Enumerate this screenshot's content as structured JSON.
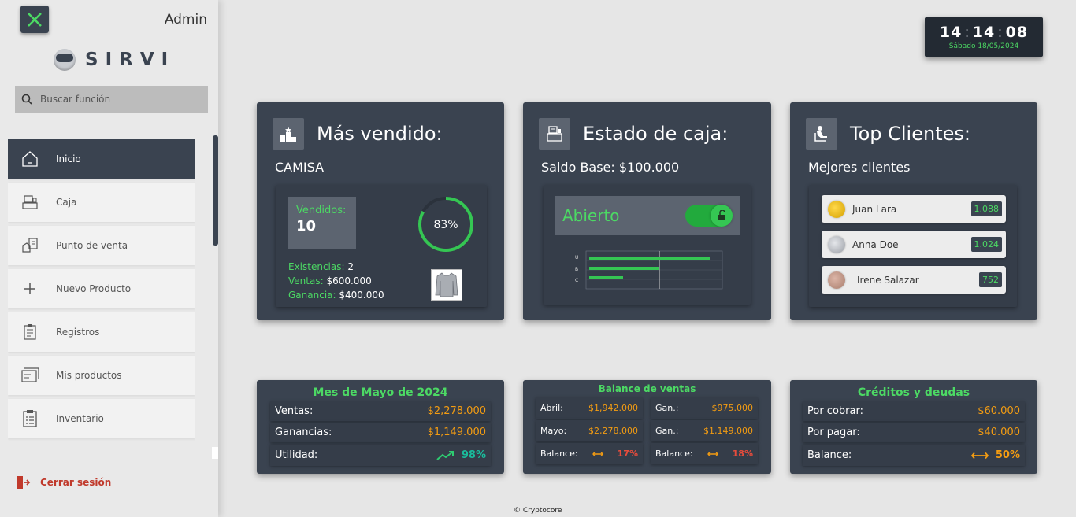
{
  "sidebar": {
    "user": "Admin",
    "logo": "SIRVI",
    "search_placeholder": "Buscar función",
    "items": [
      {
        "label": "Inicio",
        "icon": "home-icon",
        "active": true
      },
      {
        "label": "Caja",
        "icon": "cash-register-icon"
      },
      {
        "label": "Punto de venta",
        "icon": "point-of-sale-icon"
      },
      {
        "label": "Nuevo Producto",
        "icon": "plus-icon"
      },
      {
        "label": "Registros",
        "icon": "records-icon"
      },
      {
        "label": "Mis productos",
        "icon": "products-icon"
      },
      {
        "label": "Inventario",
        "icon": "inventory-icon"
      }
    ],
    "logout": "Cerrar sesión"
  },
  "clock": {
    "hh": "14",
    "mm": "14",
    "ss": "08",
    "sep": ":",
    "date": "Sábado 18/05/2024"
  },
  "best_seller": {
    "title": "Más vendido:",
    "product": "CAMISA",
    "sold_label": "Vendidos:",
    "sold_value": "10",
    "percent": "83%",
    "percent_value": 0.83,
    "stock_label": "Existencias:",
    "stock_value": "2",
    "sales_label": "Ventas:",
    "sales_value": "$600.000",
    "profit_label": "Ganancia:",
    "profit_value": "$400.000"
  },
  "cash_status": {
    "title": "Estado de caja:",
    "base": "Saldo Base: $100.000",
    "status": "Abierto",
    "chart_labels": [
      "U",
      "B",
      "C"
    ],
    "bar_fractions": [
      0.9,
      0.52,
      0.25
    ]
  },
  "top_clients": {
    "title": "Top Clientes:",
    "subtitle": "Mejores clientes",
    "clients": [
      {
        "name": "Juan Lara",
        "score": "1.088",
        "medal": "#e6b800"
      },
      {
        "name": "Anna Doe",
        "score": "1.024",
        "medal": "#b8bcc2"
      },
      {
        "name": "Irene Salazar",
        "score": "752",
        "medal": "#c49a8a"
      }
    ]
  },
  "month": {
    "title": "Mes de Mayo de 2024",
    "rows": [
      {
        "label": "Ventas:",
        "value": "$2,278.000"
      },
      {
        "label": "Ganancias:",
        "value": "$1,149.000"
      }
    ],
    "util_label": "Utilidad:",
    "util_value": "98%"
  },
  "balance": {
    "title": "Balance de ventas",
    "abril_label": "Abril:",
    "abril_value": "$1,942.000",
    "abril_gan_label": "Gan.:",
    "abril_gan_value": "$975.000",
    "mayo_label": "Mayo:",
    "mayo_value": "$2,278.000",
    "mayo_gan_label": "Gan.:",
    "mayo_gan_value": "$1,149.000",
    "bal_label": "Balance:",
    "bal_value": "17%",
    "bal2_label": "Balance:",
    "bal2_value": "18%"
  },
  "credits": {
    "title": "Créditos y deudas",
    "rows": [
      {
        "label": "Por cobrar:",
        "value": "$60.000"
      },
      {
        "label": "Por pagar:",
        "value": "$40.000"
      }
    ],
    "bal_label": "Balance:",
    "bal_value": "50%"
  },
  "footer": "© Cryptocore",
  "colors": {
    "accent": "#4cd964",
    "card": "#3a4350",
    "orange": "#f39c12",
    "red": "#e74c3c"
  }
}
